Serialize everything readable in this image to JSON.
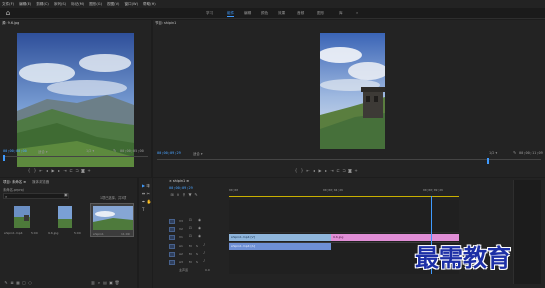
{
  "menu": [
    "文件(F)",
    "编辑(E)",
    "剪辑(C)",
    "序列(S)",
    "标记(M)",
    "图形(G)",
    "视图(V)",
    "窗口(W)",
    "帮助(H)"
  ],
  "workspaces": [
    {
      "label": "学习",
      "active": false
    },
    {
      "label": "组件",
      "active": true
    },
    {
      "label": "编辑",
      "active": false
    },
    {
      "label": "颜色",
      "active": false
    },
    {
      "label": "效果",
      "active": false
    },
    {
      "label": "音频",
      "active": false
    },
    {
      "label": "图形",
      "active": false
    },
    {
      "label": "库",
      "active": false
    },
    {
      "label": "»",
      "active": false
    }
  ],
  "source": {
    "title": "源: 9.6.jpg",
    "timecode_in": "00;00;00;00",
    "fit": "适合",
    "ratio": "1/2",
    "timecode_out": "00;00;05;00"
  },
  "program": {
    "title": "节目: shipin1",
    "timecode": "00;00;09;29",
    "fit": "适合",
    "ratio": "1/2",
    "timecode_out": "00;00;11;09"
  },
  "project": {
    "tabs": [
      "项目: 未命名 ≡",
      "媒体浏览器"
    ],
    "filename": "未命名.prproj",
    "selection_info": "1项已选择，共3项",
    "items": [
      {
        "name": "shipin1.mp4",
        "meta": "5:00"
      },
      {
        "name": "9.6.jpg",
        "meta": "5:00"
      },
      {
        "name": "shipin1",
        "meta": "11:09"
      }
    ]
  },
  "timeline": {
    "title": "× shipin1 ≡",
    "timecode": "00;00;09;29",
    "ruler": [
      "00;00",
      "00;00;04;29",
      "00;00;09;29"
    ],
    "track_labels": [
      "V3",
      "V2",
      "V1",
      "A1",
      "A2",
      "A3",
      "主声道"
    ],
    "master_value": "0.0",
    "clips": {
      "v1_a": "shipin1.mp4 [V]",
      "v1_b": "9.6.jpg",
      "a1": "shipin1.mp4 [A]"
    }
  },
  "watermark": "最需教育",
  "colors": {
    "accent": "#3f9bff",
    "video_clip": "#8fb6dc",
    "image_clip": "#e08ed6",
    "audio_clip": "#6e8fd4",
    "playhead": "#3f9bff"
  }
}
